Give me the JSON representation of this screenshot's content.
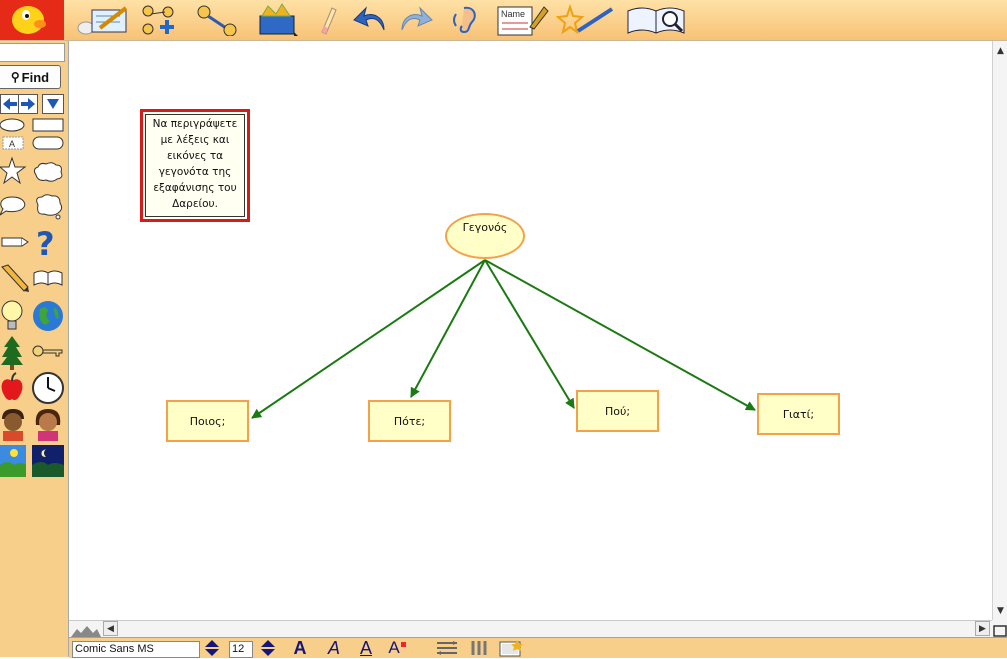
{
  "toolbar": {
    "items": [
      {
        "icon": "logo-fish-icon"
      },
      {
        "icon": "write-note-icon"
      },
      {
        "icon": "add-symbol-icon"
      },
      {
        "icon": "link-tool-icon"
      },
      {
        "icon": "template-box-icon"
      },
      {
        "icon": "eraser-icon"
      },
      {
        "icon": "undo-icon"
      },
      {
        "icon": "redo-icon"
      },
      {
        "icon": "listen-icon"
      },
      {
        "icon": "name-card-icon",
        "label": "Name"
      },
      {
        "icon": "magic-wand-icon"
      },
      {
        "icon": "dictionary-icon"
      }
    ]
  },
  "sidebar": {
    "search_value": "",
    "find_label": "Find"
  },
  "diagram": {
    "note_text": "Να περιγράψετε με λέξεις και εικόνες τα γεγονότα της εξαφάνισης του Δαρείου.",
    "center_label": "Γεγονός",
    "children": [
      "Ποιος;",
      "Πότε;",
      "Πού;",
      "Γιατί;"
    ],
    "colors": {
      "box_fill": "#ffffc7",
      "box_border": "#f4a24a",
      "link": "#1b7a12",
      "note_border": "#d71a1a",
      "toolbar_bg": "#f7cf8a"
    }
  },
  "format_bar": {
    "font": "Comic Sans MS",
    "size": "12"
  }
}
